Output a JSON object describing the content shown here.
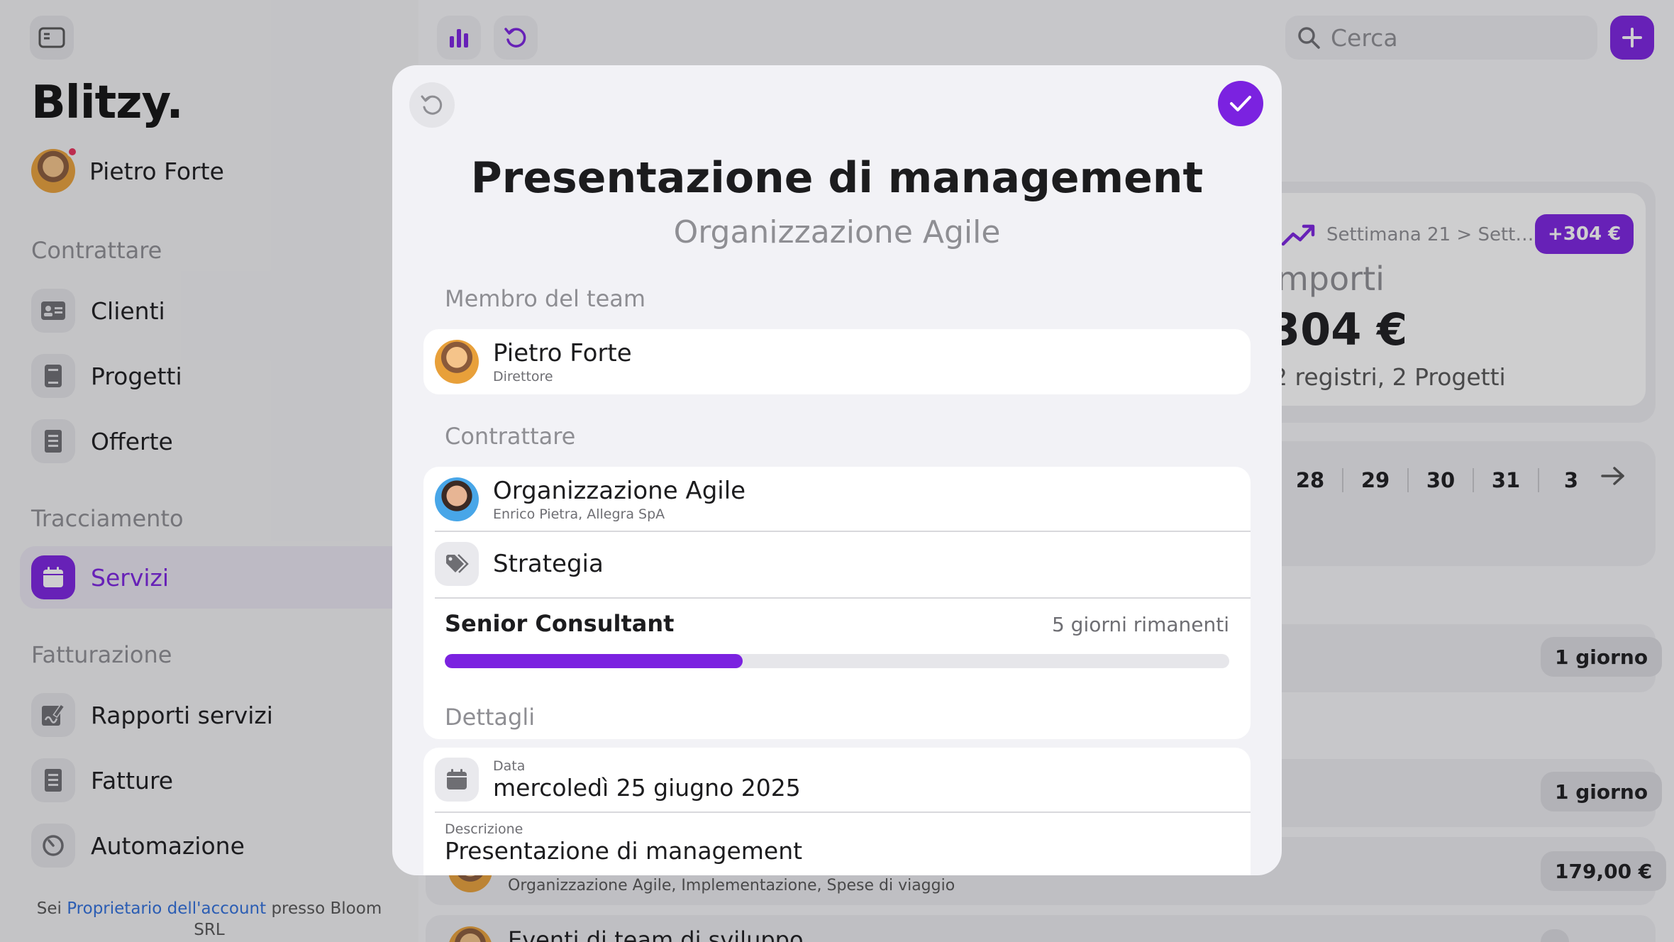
{
  "app": {
    "brand": "Blitzy.",
    "user_name": "Pietro Forte",
    "sections": {
      "contrattare": "Contrattare",
      "tracciamento": "Tracciamento",
      "fatturazione": "Fatturazione"
    },
    "nav": {
      "clienti": "Clienti",
      "progetti": "Progetti",
      "offerte": "Offerte",
      "servizi": "Servizi",
      "rapporti": "Rapporti servizi",
      "fatture": "Fatture",
      "automazione": "Automazione"
    },
    "footer": {
      "pre": "Sei ",
      "link": "Proprietario dell'account",
      "post": " presso Bloom SRL"
    },
    "accent": "#7b22e0"
  },
  "toolbar": {
    "search_placeholder": "Cerca"
  },
  "stats": {
    "week": "Settimana 21 > Sett…",
    "badge": "+304 €",
    "title": "mporti",
    "value": "304 €",
    "sub": "2 registri, 2 Progetti"
  },
  "calendar": {
    "days": [
      "28",
      "29",
      "30",
      "31",
      "3"
    ]
  },
  "list": {
    "pill_1": "1 giorno",
    "pill_2": "1 giorno",
    "pill_3": "179,00 €",
    "row3_meta": "Organizzazione Agile, Implementazione, Spese di viaggio",
    "row4_title": "Eventi di team di sviluppo"
  },
  "modal": {
    "title": "Presentazione di management",
    "subtitle": "Organizzazione Agile",
    "team_section": "Membro del team",
    "member_name": "Pietro Forte",
    "member_role": "Direttore",
    "contract_section": "Contrattare",
    "client_name": "Organizzazione Agile",
    "client_sub": "Enrico Pietra, Allegra SpA",
    "category": "Strategia",
    "service_role": "Senior Consultant",
    "remaining": "5 giorni rimanenti",
    "progress": 0.38,
    "details_section": "Dettagli",
    "date_label": "Data",
    "date_value": "mercoledì 25 giugno 2025",
    "desc_label": "Descrizione",
    "desc_value": "Presentazione di management"
  }
}
